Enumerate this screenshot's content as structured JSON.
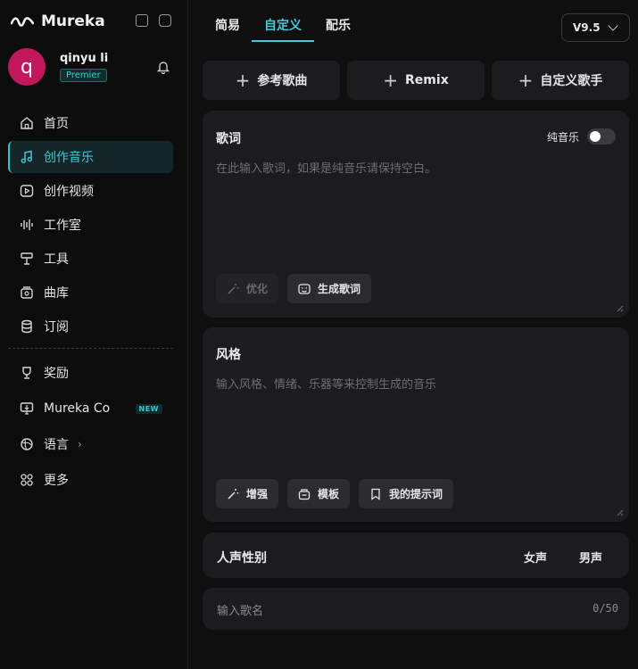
{
  "brand": {
    "name": "Mureka"
  },
  "user": {
    "initial": "q",
    "name": "qinyu li",
    "plan": "Premier"
  },
  "nav": {
    "items": [
      {
        "label": "首页",
        "icon": "home-icon",
        "active": false
      },
      {
        "label": "创作音乐",
        "icon": "music-note-icon",
        "active": true
      },
      {
        "label": "创作视频",
        "icon": "video-icon",
        "active": false
      },
      {
        "label": "工作室",
        "icon": "waveform-icon",
        "active": false
      },
      {
        "label": "工具",
        "icon": "tool-icon",
        "active": false
      },
      {
        "label": "曲库",
        "icon": "library-icon",
        "active": false
      },
      {
        "label": "订阅",
        "icon": "database-icon",
        "active": false
      }
    ],
    "lower": [
      {
        "label": "奖励",
        "icon": "trophy-icon"
      },
      {
        "label": "Mureka Co",
        "icon": "monitor-icon",
        "badge": "NEW"
      },
      {
        "label": "语言",
        "icon": "globe-icon",
        "chevron": "›"
      },
      {
        "label": "更多",
        "icon": "grid-icon"
      }
    ]
  },
  "tabs": [
    {
      "label": "简易",
      "active": false
    },
    {
      "label": "自定义",
      "active": true
    },
    {
      "label": "配乐",
      "active": false
    }
  ],
  "version": "V9.5",
  "quick_actions": [
    {
      "label": "参考歌曲"
    },
    {
      "label": "Remix"
    },
    {
      "label": "自定义歌手"
    }
  ],
  "lyrics": {
    "title": "歌词",
    "instrumental_label": "纯音乐",
    "instrumental_on": false,
    "placeholder": "在此输入歌词，如果是纯音乐请保持空白。",
    "optimize_label": "优化",
    "generate_label": "生成歌词"
  },
  "style": {
    "title": "风格",
    "placeholder": "输入风格、情绪、乐器等来控制生成的音乐",
    "enhance_label": "增强",
    "template_label": "模板",
    "prompts_label": "我的提示词"
  },
  "voice": {
    "label": "人声性别",
    "female": "女声",
    "male": "男声"
  },
  "song_name": {
    "placeholder": "输入歌名",
    "counter": "0/50"
  },
  "colors": {
    "accent": "#47c8d6",
    "avatar": "#c2185b",
    "panel": "#1c1c1e",
    "background": "#0f0f10"
  }
}
